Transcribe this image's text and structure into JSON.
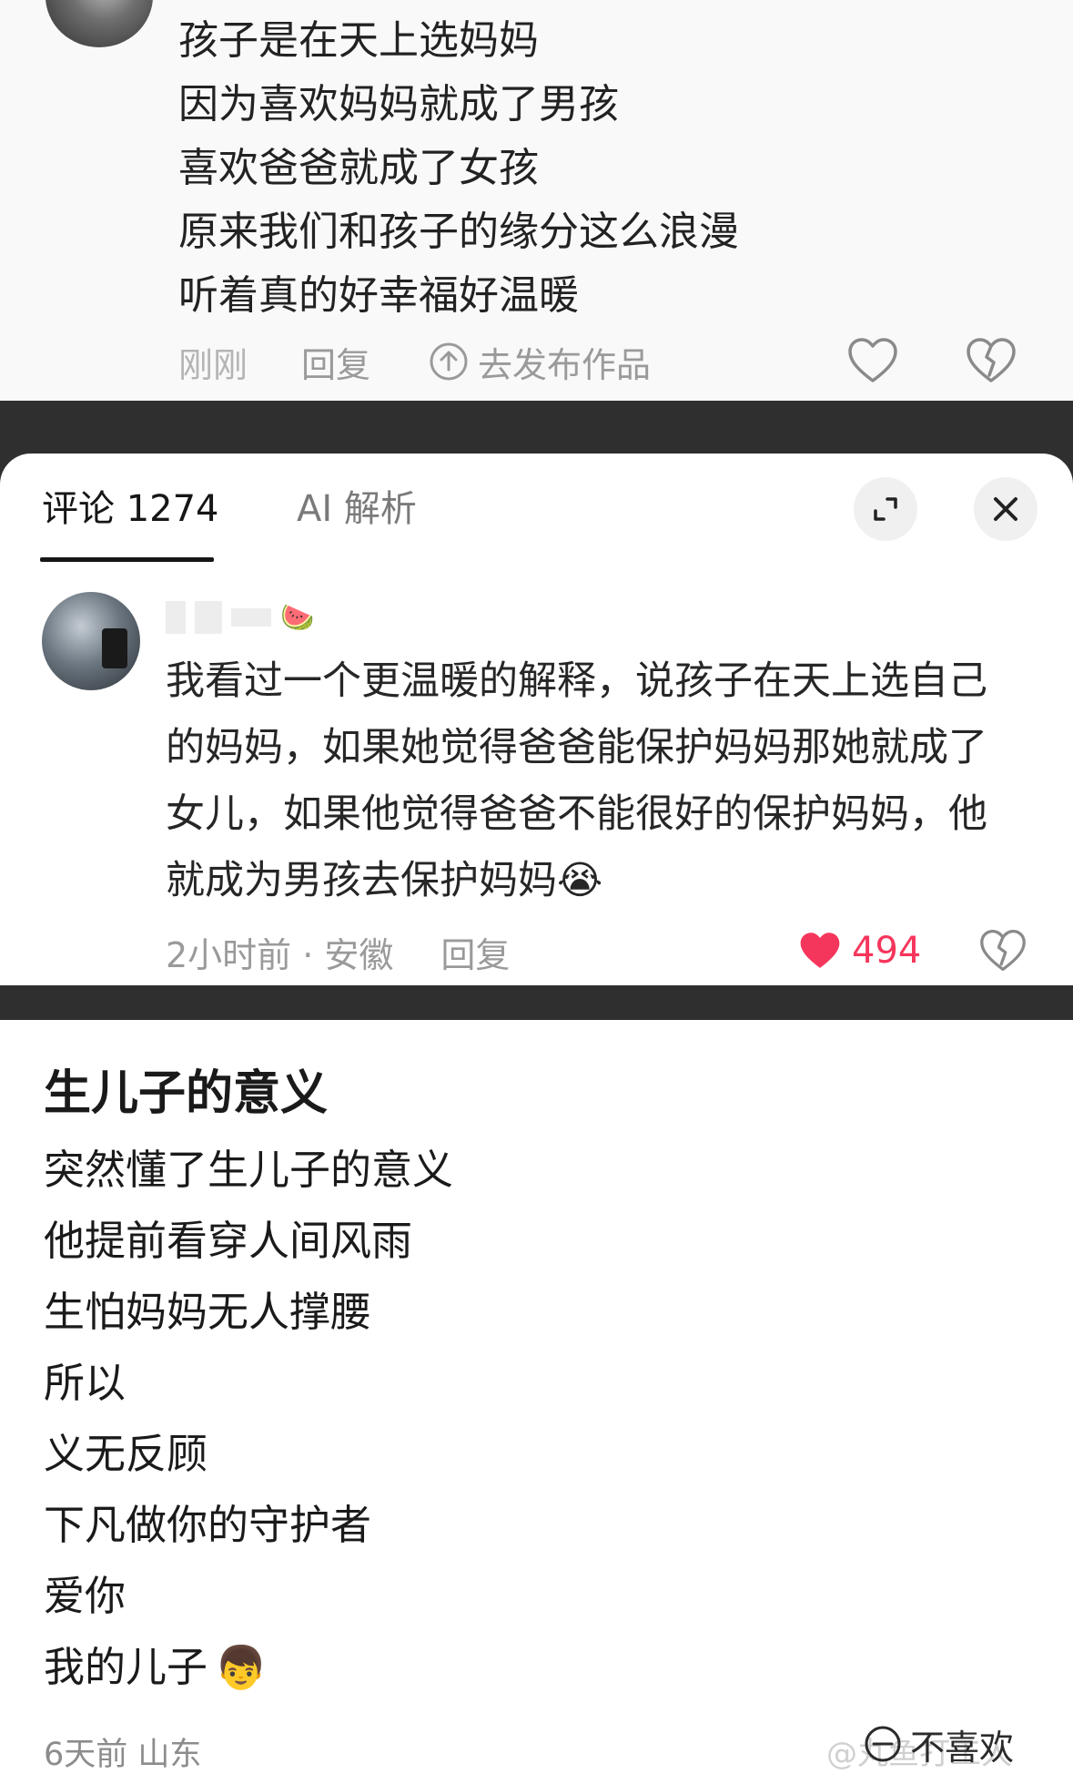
{
  "top_comment": {
    "lines": [
      "孩子是在天上选妈妈",
      "因为喜欢妈妈就成了男孩",
      "喜欢爸爸就成了女孩",
      "原来我们和孩子的缘分这么浪漫",
      "听着真的好幸福好温暖"
    ],
    "time": "刚刚",
    "reply_label": "回复",
    "publish_label": "去发布作品"
  },
  "sheet": {
    "tabs": [
      {
        "label": "评论 1274",
        "selected": true
      },
      {
        "label": "AI 解析",
        "selected": false
      }
    ]
  },
  "comment": {
    "body": "我看过一个更温暖的解释，说孩子在天上选自己的妈妈，如果她觉得爸爸能保护妈妈那她就成了女儿，如果他觉得爸爸不能很好的保护妈妈，他就成为男孩去保护妈妈",
    "emoji": "😭",
    "name_emoji": "🍉",
    "meta": "2小时前 · 安徽",
    "reply_label": "回复",
    "likes": "494",
    "like_color": "#f5365c"
  },
  "note": {
    "title": "生儿子的意义",
    "lines": [
      {
        "text": "突然懂了生儿子的意义"
      },
      {
        "text": "他提前看穿人间风雨"
      },
      {
        "text": "生怕妈妈无人撑腰"
      },
      {
        "text": "所以"
      },
      {
        "text": "义无反顾"
      },
      {
        "text": "下凡做你的守护者"
      },
      {
        "text": "爱你"
      },
      {
        "text": "我的儿子",
        "emoji": "👦"
      }
    ],
    "footer": "6天前 山东",
    "dislike_label": "不喜欢",
    "watermark": "@丸鱼打工人"
  }
}
